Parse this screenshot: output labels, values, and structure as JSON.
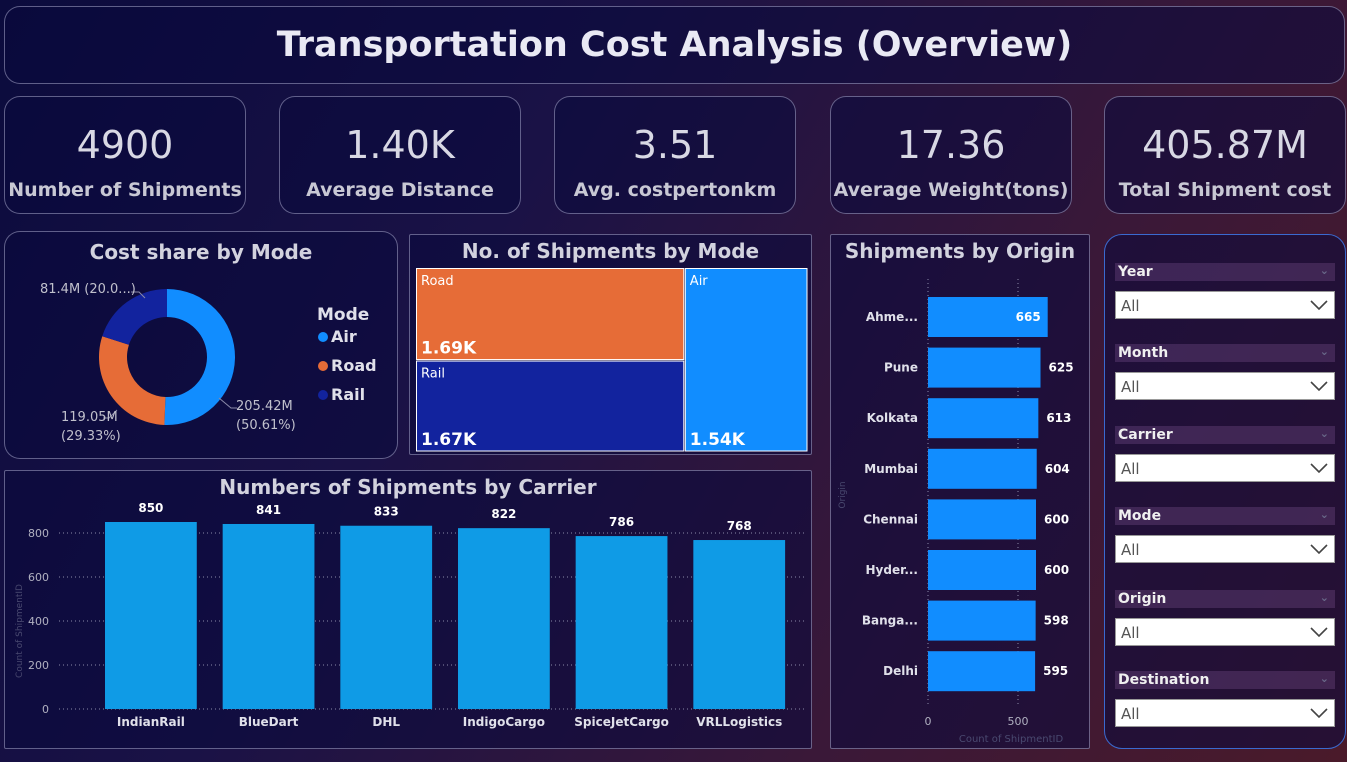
{
  "header": {
    "title": "Transportation Cost Analysis (Overview)"
  },
  "kpis": [
    {
      "value": "4900",
      "label": "Number of Shipments"
    },
    {
      "value": "1.40K",
      "label": "Average Distance"
    },
    {
      "value": "3.51",
      "label": "Avg. costpertonkm"
    },
    {
      "value": "17.36",
      "label": "Average Weight(tons)"
    },
    {
      "value": "405.87M",
      "label": "Total Shipment cost"
    }
  ],
  "slicers": [
    {
      "label": "Year",
      "value": "All"
    },
    {
      "label": "Month",
      "value": "All"
    },
    {
      "label": "Carrier",
      "value": "All"
    },
    {
      "label": "Mode",
      "value": "All"
    },
    {
      "label": "Origin",
      "value": "All"
    },
    {
      "label": "Destination",
      "value": "All"
    }
  ],
  "colors": {
    "air": "#118dff",
    "road": "#e66c37",
    "rail": "#12239e",
    "bar": "#0f9be6",
    "bar_origin": "#118dff"
  },
  "chart_data": [
    {
      "type": "pie",
      "title": "Cost share by Mode",
      "legend_title": "Mode",
      "legend_position": "right",
      "categories": [
        "Air",
        "Road",
        "Rail"
      ],
      "values": [
        205.42,
        119.05,
        81.4
      ],
      "data_labels": [
        "205.42M\n(50.61%)",
        "119.05M\n(29.33%)",
        "81.4M (20.0...)"
      ]
    },
    {
      "type": "heatmap",
      "title": "No. of Shipments by Mode",
      "categories": [
        "Road",
        "Rail",
        "Air"
      ],
      "values": [
        1690,
        1670,
        1540
      ],
      "data_labels": [
        "1.69K",
        "1.67K",
        "1.54K"
      ]
    },
    {
      "type": "bar",
      "title": "Numbers of Shipments by Carrier",
      "categories": [
        "IndianRail",
        "BlueDart",
        "DHL",
        "IndigoCargo",
        "SpiceJetCargo",
        "VRLLogistics"
      ],
      "values": [
        850,
        841,
        833,
        822,
        786,
        768
      ],
      "ylabel": "Count of ShipmentID",
      "ylim": [
        0,
        900
      ],
      "yticks": [
        "0",
        "200",
        "400",
        "600",
        "800"
      ],
      "grid": true
    },
    {
      "type": "bar",
      "orientation": "horizontal",
      "title": "Shipments by Origin",
      "categories": [
        "Ahme...",
        "Pune",
        "Kolkata",
        "Mumbai",
        "Chennai",
        "Hyder...",
        "Banga...",
        "Delhi"
      ],
      "values": [
        665,
        625,
        613,
        604,
        600,
        600,
        598,
        595
      ],
      "xlabel": "Count of ShipmentID",
      "ylabel": "Origin",
      "xlim": [
        0,
        700
      ],
      "xticks": [
        "0",
        "500"
      ]
    }
  ]
}
